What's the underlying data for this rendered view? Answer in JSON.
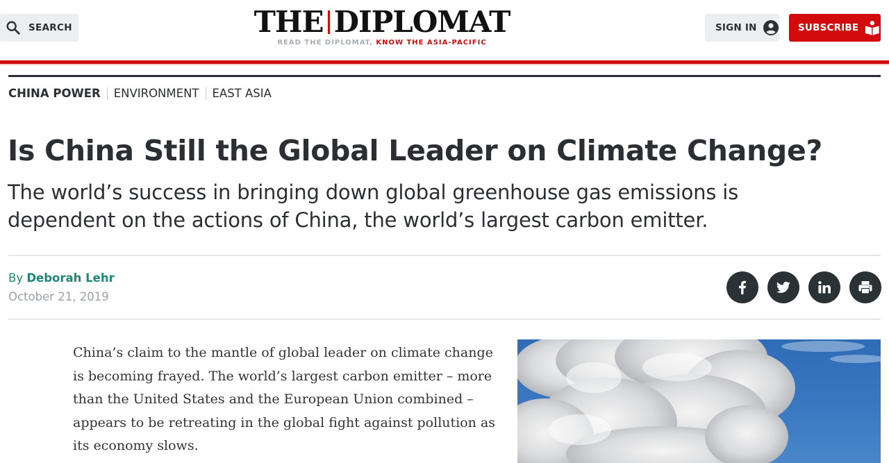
{
  "header": {
    "search_label": "SEARCH",
    "logo": {
      "left": "THE",
      "right": "DIPLOMAT",
      "tagline_grey": "READ THE DIPLOMAT,",
      "tagline_red": " KNOW THE ASIA-PACIFIC"
    },
    "signin_label": "SIGN IN",
    "subscribe_label": "SUBSCRIBE"
  },
  "categories": [
    "CHINA POWER",
    "ENVIRONMENT",
    "EAST ASIA"
  ],
  "article": {
    "title": "Is China Still the Global Leader on Climate Change?",
    "subtitle": "The world’s success in bringing down global greenhouse gas emissions is dependent on the actions of China, the world’s largest carbon emitter.",
    "by_prefix": "By",
    "author": "Deborah Lehr",
    "date": "October 21, 2019",
    "body_paragraph": "China’s claim to the mantle of global leader on climate change is becoming frayed. The world’s largest carbon emitter – more than the United States and the European Union combined – appears to be retreating in the global fight against pollution as its economy slows."
  },
  "share_icons": [
    "facebook-icon",
    "twitter-icon",
    "linkedin-icon",
    "print-icon"
  ],
  "colors": {
    "brand_red": "#d20c0c",
    "author_teal": "#1f8a74",
    "dark": "#2b3236"
  }
}
